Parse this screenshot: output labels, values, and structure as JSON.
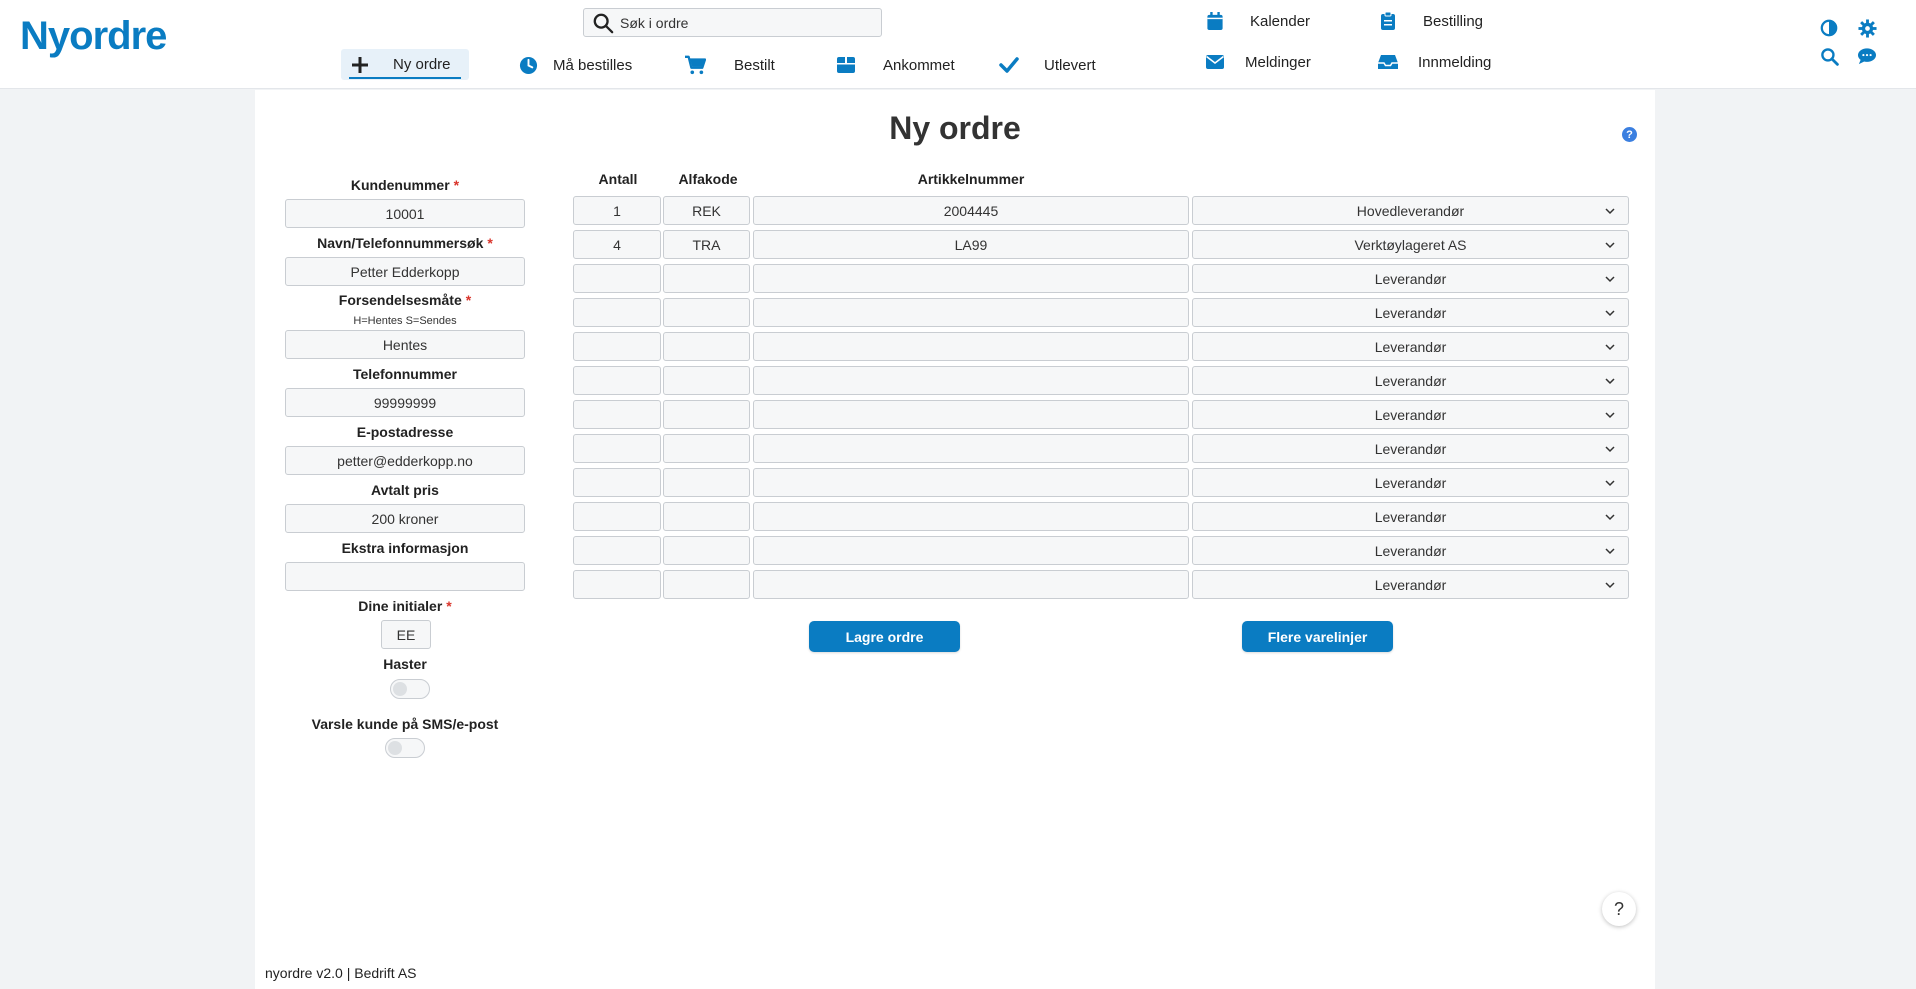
{
  "app": {
    "logo": "Nyordre",
    "footer": "nyordre v2.0 | Bedrift AS"
  },
  "search": {
    "placeholder": "Søk i ordre"
  },
  "nav": {
    "new_order": "Ny ordre",
    "must_order": "Må bestilles",
    "ordered": "Bestilt",
    "arrived": "Ankommet",
    "delivered": "Utlevert",
    "calendar": "Kalender",
    "order": "Bestilling",
    "messages": "Meldinger",
    "intake": "Innmelding"
  },
  "page": {
    "title": "Ny ordre",
    "help": "?"
  },
  "form": {
    "customer_number": {
      "label": "Kundenummer",
      "value": "10001"
    },
    "name_search": {
      "label": "Navn/Telefonnummersøk",
      "value": "Petter Edderkopp"
    },
    "shipping": {
      "label": "Forsendelsesmåte",
      "hint": "H=Hentes S=Sendes",
      "value": "Hentes"
    },
    "phone": {
      "label": "Telefonnummer",
      "value": "99999999"
    },
    "email": {
      "label": "E-postadresse",
      "value": "petter@edderkopp.no"
    },
    "price": {
      "label": "Avtalt pris",
      "value": "200 kroner"
    },
    "extra": {
      "label": "Ekstra informasjon",
      "value": ""
    },
    "initials": {
      "label": "Dine initialer",
      "value": "EE"
    },
    "urgent": {
      "label": "Haster"
    },
    "notify": {
      "label": "Varsle kunde på SMS/e-post"
    },
    "required_mark": "*"
  },
  "table": {
    "headers": {
      "qty": "Antall",
      "alpha": "Alfakode",
      "article": "Artikkelnummer"
    },
    "rows": [
      {
        "qty": "1",
        "alpha": "REK",
        "article": "2004445",
        "supplier": "Hovedleverandør"
      },
      {
        "qty": "4",
        "alpha": "TRA",
        "article": "LA99",
        "supplier": "Verktøylageret AS"
      },
      {
        "qty": "",
        "alpha": "",
        "article": "",
        "supplier": "Leverandør"
      },
      {
        "qty": "",
        "alpha": "",
        "article": "",
        "supplier": "Leverandør"
      },
      {
        "qty": "",
        "alpha": "",
        "article": "",
        "supplier": "Leverandør"
      },
      {
        "qty": "",
        "alpha": "",
        "article": "",
        "supplier": "Leverandør"
      },
      {
        "qty": "",
        "alpha": "",
        "article": "",
        "supplier": "Leverandør"
      },
      {
        "qty": "",
        "alpha": "",
        "article": "",
        "supplier": "Leverandør"
      },
      {
        "qty": "",
        "alpha": "",
        "article": "",
        "supplier": "Leverandør"
      },
      {
        "qty": "",
        "alpha": "",
        "article": "",
        "supplier": "Leverandør"
      },
      {
        "qty": "",
        "alpha": "",
        "article": "",
        "supplier": "Leverandør"
      },
      {
        "qty": "",
        "alpha": "",
        "article": "",
        "supplier": "Leverandør"
      }
    ]
  },
  "buttons": {
    "save": "Lagre ordre",
    "more_lines": "Flere varelinjer"
  },
  "help_button": "?",
  "colors": {
    "accent": "#0a7cc2",
    "required": "#d9342b"
  }
}
